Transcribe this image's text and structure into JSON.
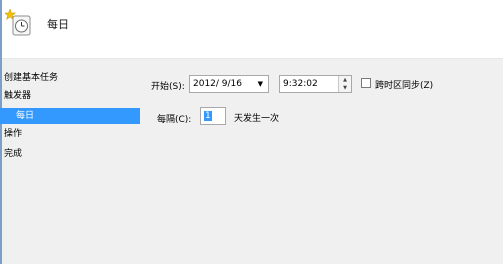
{
  "header": {
    "title": "每日"
  },
  "sidebar": {
    "items": [
      {
        "label": "创建基本任务"
      },
      {
        "label": "触发器"
      },
      {
        "label": "每日"
      },
      {
        "label": "操作"
      },
      {
        "label": "完成"
      }
    ]
  },
  "form": {
    "start_label": "开始(S):",
    "date_value": "2012/  9/16",
    "time_value": "9:32:02",
    "sync_timezone_label": "跨时区同步(Z)",
    "sync_timezone_checked": false,
    "recur_label": "每隔(C):",
    "recur_value": "1",
    "recur_suffix": "天发生一次"
  },
  "icons": {
    "header": "task-scheduler-clock-icon",
    "date_dropdown": "dropdown-arrow-icon",
    "time_spinner": "spinner-icon"
  }
}
